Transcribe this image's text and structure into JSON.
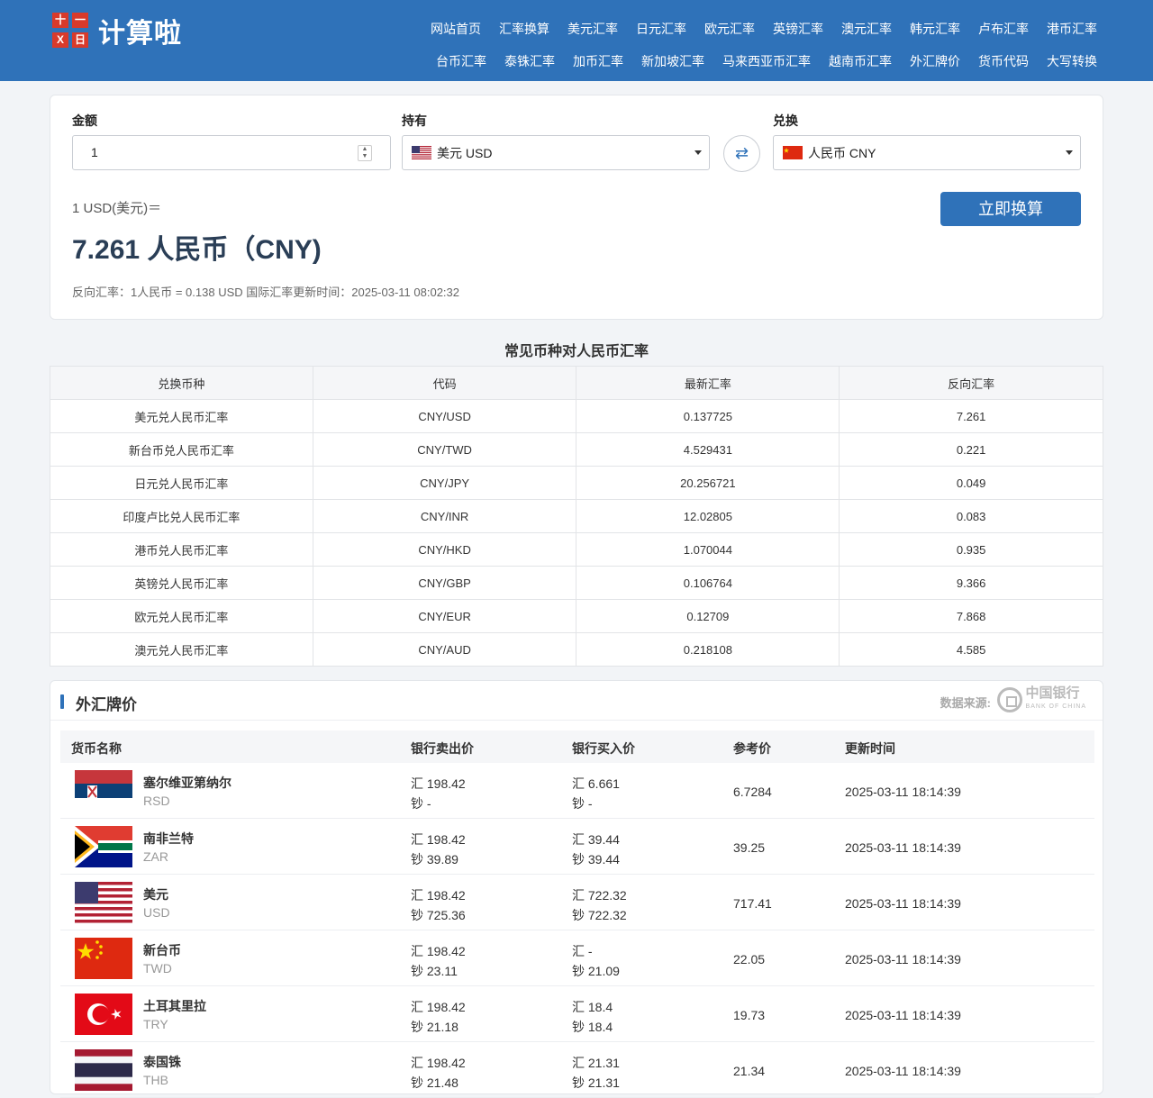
{
  "header": {
    "logo_text": "计算啦",
    "logo_marks": [
      "十",
      "一",
      "X",
      "日"
    ],
    "nav_row1": [
      "网站首页",
      "汇率换算",
      "美元汇率",
      "日元汇率",
      "欧元汇率",
      "英镑汇率",
      "澳元汇率",
      "韩元汇率",
      "卢布汇率",
      "港币汇率"
    ],
    "nav_row2": [
      "台币汇率",
      "泰铢汇率",
      "加币汇率",
      "新加坡汇率",
      "马来西亚币汇率",
      "越南币汇率",
      "外汇牌价",
      "货币代码",
      "大写转换"
    ]
  },
  "converter": {
    "amount_label": "金额",
    "amount_value": "1",
    "from_label": "持有",
    "from_value": "美元 USD",
    "to_label": "兑换",
    "to_value": "人民币 CNY",
    "swap_icon": "⇄",
    "result_label": "1 USD(美元)＝",
    "result_value": "7.261 人民币（CNY)",
    "convert_button": "立即换算",
    "note": "反向汇率：1人民币 = 0.138 USD  国际汇率更新时间：2025-03-11 08:02:32"
  },
  "rate_table": {
    "title": "常见币种对人民币汇率",
    "headers": [
      "兑换币种",
      "代码",
      "最新汇率",
      "反向汇率"
    ],
    "rows": [
      [
        "美元兑人民币汇率",
        "CNY/USD",
        "0.137725",
        "7.261"
      ],
      [
        "新台币兑人民币汇率",
        "CNY/TWD",
        "4.529431",
        "0.221"
      ],
      [
        "日元兑人民币汇率",
        "CNY/JPY",
        "20.256721",
        "0.049"
      ],
      [
        "印度卢比兑人民币汇率",
        "CNY/INR",
        "12.02805",
        "0.083"
      ],
      [
        "港币兑人民币汇率",
        "CNY/HKD",
        "1.070044",
        "0.935"
      ],
      [
        "英镑兑人民币汇率",
        "CNY/GBP",
        "0.106764",
        "9.366"
      ],
      [
        "欧元兑人民币汇率",
        "CNY/EUR",
        "0.12709",
        "7.868"
      ],
      [
        "澳元兑人民币汇率",
        "CNY/AUD",
        "0.218108",
        "4.585"
      ]
    ]
  },
  "forex": {
    "title": "外汇牌价",
    "source_label": "数据来源:",
    "bank_name": "中国银行",
    "bank_name_en": "BANK OF CHINA",
    "columns": [
      "货币名称",
      "银行卖出价",
      "银行买入价",
      "参考价",
      "更新时间"
    ],
    "rows": [
      {
        "name": "塞尔维亚第纳尔",
        "code": "RSD",
        "sell1": "汇 198.42",
        "sell2": "钞 -",
        "buy1": "汇 6.661",
        "buy2": "钞 -",
        "ref": "6.7284",
        "time": "2025-03-11 18:14:39",
        "flag": "rsd"
      },
      {
        "name": "南非兰特",
        "code": "ZAR",
        "sell1": "汇 198.42",
        "sell2": "钞 39.89",
        "buy1": "汇 39.44",
        "buy2": "钞 39.44",
        "ref": "39.25",
        "time": "2025-03-11 18:14:39",
        "flag": "zar"
      },
      {
        "name": "美元",
        "code": "USD",
        "sell1": "汇 198.42",
        "sell2": "钞 725.36",
        "buy1": "汇 722.32",
        "buy2": "钞 722.32",
        "ref": "717.41",
        "time": "2025-03-11 18:14:39",
        "flag": "usd"
      },
      {
        "name": "新台币",
        "code": "TWD",
        "sell1": "汇 198.42",
        "sell2": "钞 23.11",
        "buy1": "汇 -",
        "buy2": "钞 21.09",
        "ref": "22.05",
        "time": "2025-03-11 18:14:39",
        "flag": "cny"
      },
      {
        "name": "土耳其里拉",
        "code": "TRY",
        "sell1": "汇 198.42",
        "sell2": "钞 21.18",
        "buy1": "汇 18.4",
        "buy2": "钞 18.4",
        "ref": "19.73",
        "time": "2025-03-11 18:14:39",
        "flag": "try"
      },
      {
        "name": "泰国铢",
        "code": "THB",
        "sell1": "汇 198.42",
        "sell2": "钞 21.48",
        "buy1": "汇 21.31",
        "buy2": "钞 21.31",
        "ref": "21.34",
        "time": "2025-03-11 18:14:39",
        "flag": "thb"
      }
    ]
  }
}
